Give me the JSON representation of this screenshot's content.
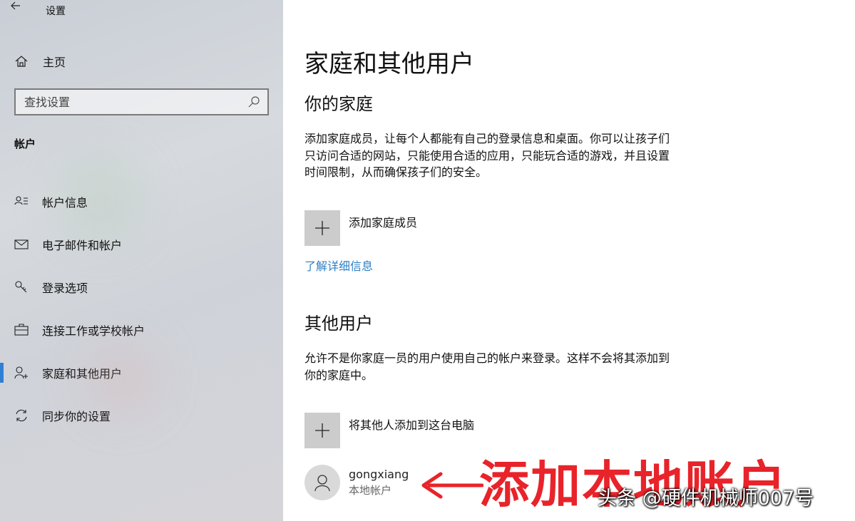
{
  "window": {
    "title": "设置",
    "back_icon": "back-arrow-icon"
  },
  "sidebar": {
    "home_label": "主页",
    "search_placeholder": "查找设置",
    "section_heading": "帐户",
    "items": [
      {
        "label": "帐户信息",
        "icon": "account-info-icon",
        "active": false
      },
      {
        "label": "电子邮件和帐户",
        "icon": "email-icon",
        "active": false
      },
      {
        "label": "登录选项",
        "icon": "key-icon",
        "active": false
      },
      {
        "label": "连接工作或学校帐户",
        "icon": "briefcase-icon",
        "active": false
      },
      {
        "label": "家庭和其他用户",
        "icon": "add-user-icon",
        "active": true
      },
      {
        "label": "同步你的设置",
        "icon": "sync-icon",
        "active": false
      }
    ],
    "accent_color": "#2f7fd4"
  },
  "main": {
    "title": "家庭和其他用户",
    "family": {
      "heading": "你的家庭",
      "description_lines": [
        "添加家庭成员，让每个人都能有自己的登录信息和桌面。你可以让孩子们",
        "只访问合适的网站，只能使用合适的应用，只能玩合适的游戏，并且设置",
        "时间限制，从而确保孩子们的安全。"
      ],
      "add_label": "添加家庭成员",
      "learn_more": "了解详细信息"
    },
    "others": {
      "heading": "其他用户",
      "description_lines": [
        "允许不是你家庭一员的用户使用自己的帐户来登录。这样不会将其添加到",
        "你的家庭中。"
      ],
      "add_label": "将其他人添加到这台电脑",
      "users": [
        {
          "name": "gongxiang",
          "type": "本地帐户"
        }
      ]
    }
  },
  "annotation": {
    "text": "添加本地账户",
    "color": "#e8232a",
    "watermark": "头条 @硬件机械师007号"
  }
}
